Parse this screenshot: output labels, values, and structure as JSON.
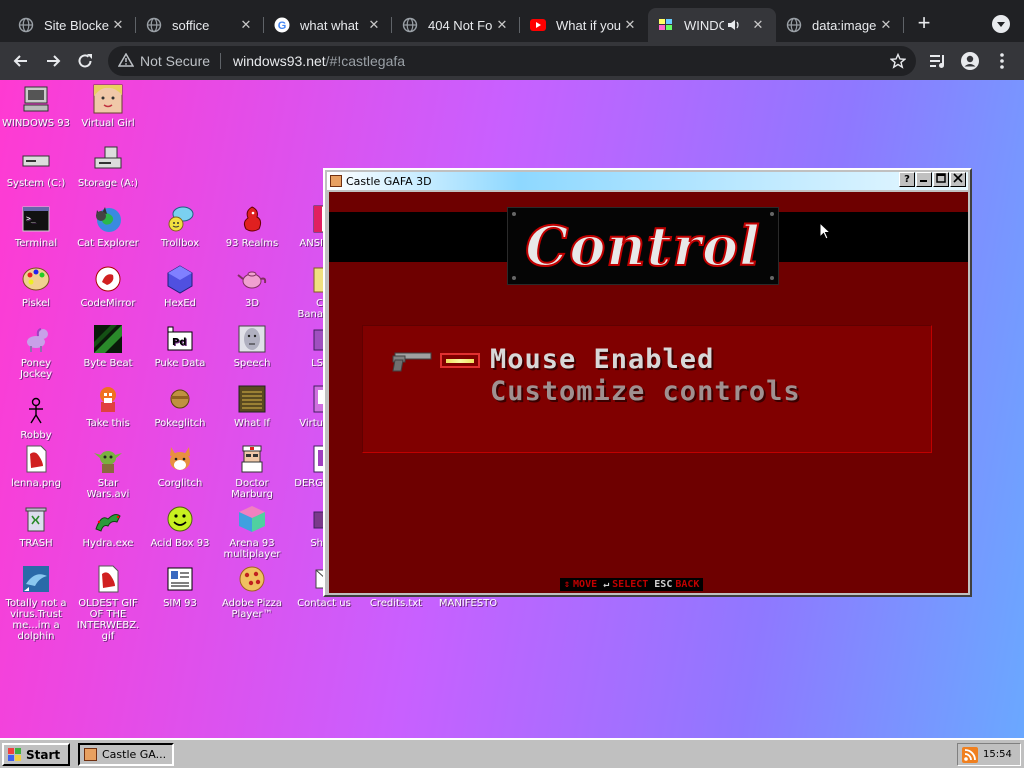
{
  "browser": {
    "tabs": [
      {
        "title": "Site Blocke",
        "favicon": "globe-icon",
        "active": false
      },
      {
        "title": "soffice",
        "favicon": "globe-icon",
        "active": false
      },
      {
        "title": "what what",
        "favicon": "google-icon",
        "active": false
      },
      {
        "title": "404 Not Fo",
        "favicon": "globe-icon",
        "active": false
      },
      {
        "title": "What if you",
        "favicon": "youtube-icon",
        "active": false
      },
      {
        "title": "WINDO",
        "favicon": "windows93-icon",
        "active": true
      },
      {
        "title": "data:image",
        "favicon": "globe-icon",
        "active": false
      }
    ],
    "security_label": "Not Secure",
    "url_host": "windows93.net",
    "url_path": "/#!castlegafa"
  },
  "desktop": {
    "icons": [
      {
        "label": "WINDOWS 93",
        "icon": "computer-icon"
      },
      {
        "label": "Virtual Girl",
        "icon": "face-icon"
      },
      {
        "label": "System (C:)",
        "icon": "drive-icon"
      },
      {
        "label": "Storage (A:)",
        "icon": "floppy-drive-icon"
      },
      {
        "label": "Terminal",
        "icon": "terminal-icon"
      },
      {
        "label": "Cat Explorer",
        "icon": "cat-globe-icon"
      },
      {
        "label": "Trollbox",
        "icon": "chat-icon"
      },
      {
        "label": "93 Realms",
        "icon": "dragon-icon"
      },
      {
        "label": "ANSI",
        "icon": "ansi-icon"
      },
      {
        "label": "Piskel",
        "icon": "palette-icon"
      },
      {
        "label": "CodeMirror",
        "icon": "codemirror-icon"
      },
      {
        "label": "HexEd",
        "icon": "hex-icon"
      },
      {
        "label": "3D",
        "icon": "teapot-icon"
      },
      {
        "label": "C",
        "label2": "Bana",
        "icon": "banana-icon"
      },
      {
        "label": "Poney",
        "label2": "Jockey",
        "icon": "pony-icon"
      },
      {
        "label": "Byte Beat",
        "icon": "bytebeat-icon"
      },
      {
        "label": "Puke Data",
        "icon": "pd-icon"
      },
      {
        "label": "Speech",
        "icon": "speech-face-icon"
      },
      {
        "label": "LS",
        "icon": "ls-icon"
      },
      {
        "label": "Robby",
        "icon": "stickman-icon"
      },
      {
        "label": "Take this",
        "icon": "character-icon"
      },
      {
        "label": "Pokeglitch",
        "icon": "pokeglitch-icon"
      },
      {
        "label": "What If",
        "icon": "whatif-icon"
      },
      {
        "label": "Virtu",
        "icon": "virtual-icon"
      },
      {
        "label": "lenna.png",
        "icon": "image-file-icon"
      },
      {
        "label": "Star",
        "label2": "Wars.avi",
        "icon": "yoda-icon"
      },
      {
        "label": "Corglitch",
        "icon": "corgi-icon"
      },
      {
        "label": "Doctor",
        "label2": "Marburg",
        "icon": "doctor-icon"
      },
      {
        "label": "DERG",
        "icon": "derg-icon"
      },
      {
        "label": "TRASH",
        "icon": "trash-icon"
      },
      {
        "label": "Hydra.exe",
        "icon": "hydra-icon"
      },
      {
        "label": "Acid Box 93",
        "icon": "smiley-icon"
      },
      {
        "label": "Arena 93",
        "label2": "multiplayer",
        "icon": "cube-icon"
      },
      {
        "label": "Sh",
        "icon": "sh-icon"
      },
      {
        "label": "Totally not a",
        "label2": "virus.Trust",
        "label3": "me...im a",
        "label4": "dolphin",
        "icon": "dolphin-icon"
      },
      {
        "label": "OLDEST GIF",
        "label2": "OF THE",
        "label3": "INTERWEBZ.",
        "label4": "gif",
        "icon": "gif-file-icon"
      },
      {
        "label": "SIM 93",
        "icon": "sim-icon"
      },
      {
        "label": "Adobe Pizza",
        "label2": "Player™",
        "icon": "pizza-icon"
      },
      {
        "label": "Contact us",
        "icon": "contact-icon"
      },
      {
        "label": "Credits.txt",
        "icon": "text-file-icon"
      },
      {
        "label": "MANIFESTO",
        "icon": "manifesto-icon"
      }
    ]
  },
  "window": {
    "title": "Castle GAFA 3D",
    "help_glyph": "?",
    "game": {
      "logo_text": "Control",
      "menu": {
        "selected": "Mouse Enabled",
        "other": "Customize controls"
      },
      "footer": {
        "move": "MOVE",
        "select": "SELECT",
        "esc": "ESC",
        "back": "BACK"
      }
    }
  },
  "taskbar": {
    "start_label": "Start",
    "task_label": "Castle GA...",
    "clock": "15:54"
  },
  "colors": {
    "game_bg": "#6e0000",
    "menu_bg": "#800000",
    "accent_red": "#c00000"
  }
}
